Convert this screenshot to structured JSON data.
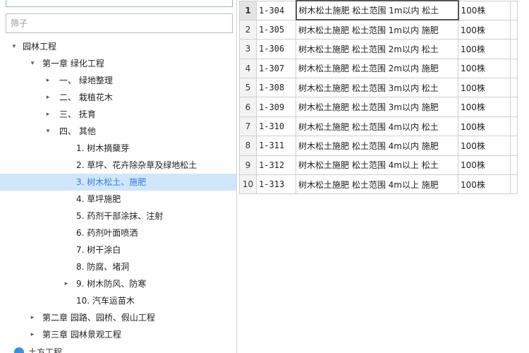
{
  "filter": {
    "placeholder": "筛子"
  },
  "tree": [
    {
      "label": "园林工程",
      "level": 0,
      "arrow": "▾"
    },
    {
      "label": "第一章 绿化工程",
      "level": 1,
      "arrow": "▾"
    },
    {
      "label": "一、  绿地整理",
      "level": 2,
      "arrow": "▸"
    },
    {
      "label": "二、  栽植花木",
      "level": 2,
      "arrow": "▸"
    },
    {
      "label": "三、  抚育",
      "level": 2,
      "arrow": "▸"
    },
    {
      "label": "四、  其他",
      "level": 2,
      "arrow": "▾"
    },
    {
      "label": "1. 树木摘蘖芽",
      "level": 3,
      "arrow": ""
    },
    {
      "label": "2. 草坪、花卉除杂草及绿地松土",
      "level": 3,
      "arrow": ""
    },
    {
      "label": "3. 树木松土、施肥",
      "level": 3,
      "arrow": "",
      "selected": true
    },
    {
      "label": "4. 草坪施肥",
      "level": 3,
      "arrow": ""
    },
    {
      "label": "5. 药剂干部涂抹、注射",
      "level": 3,
      "arrow": ""
    },
    {
      "label": "6. 药剂叶面喷洒",
      "level": 3,
      "arrow": ""
    },
    {
      "label": "7. 树干涂白",
      "level": 3,
      "arrow": ""
    },
    {
      "label": "8. 防腐、堵洞",
      "level": 3,
      "arrow": ""
    },
    {
      "label": "9. 树木防风、防寒",
      "level": 3,
      "arrow": "▸"
    },
    {
      "label": "10. 汽车运苗木",
      "level": 3,
      "arrow": ""
    },
    {
      "label": "第二章 园路、园桥、假山工程",
      "level": 1,
      "arrow": "▸"
    },
    {
      "label": "第三章 园林景观工程",
      "level": 1,
      "arrow": "▸"
    }
  ],
  "bottom_item": {
    "label": "土方工程"
  },
  "grid": [
    {
      "num": "1",
      "code": "1-304",
      "name": "树木松土施肥 松土范围 1m以内 松土",
      "unit": "100株"
    },
    {
      "num": "2",
      "code": "1-305",
      "name": "树木松土施肥 松土范围 1m以内 施肥",
      "unit": "100株"
    },
    {
      "num": "3",
      "code": "1-306",
      "name": "树木松土施肥 松土范围 2m以内 松土",
      "unit": "100株"
    },
    {
      "num": "4",
      "code": "1-307",
      "name": "树木松土施肥 松土范围 2m以内 施肥",
      "unit": "100株"
    },
    {
      "num": "5",
      "code": "1-308",
      "name": "树木松土施肥 松土范围 3m以内 松土",
      "unit": "100株"
    },
    {
      "num": "6",
      "code": "1-309",
      "name": "树木松土施肥 松土范围 3m以内 施肥",
      "unit": "100株"
    },
    {
      "num": "7",
      "code": "1-310",
      "name": "树木松土施肥 松土范围 4m以内 松土",
      "unit": "100株"
    },
    {
      "num": "8",
      "code": "1-311",
      "name": "树木松土施肥 松土范围 4m以内 施肥",
      "unit": "100株"
    },
    {
      "num": "9",
      "code": "1-312",
      "name": "树木松土施肥 松土范围 4m以上 松土",
      "unit": "100株"
    },
    {
      "num": "10",
      "code": "1-313",
      "name": "树木松土施肥 松土范围 4m以上 施肥",
      "unit": "100株"
    }
  ]
}
